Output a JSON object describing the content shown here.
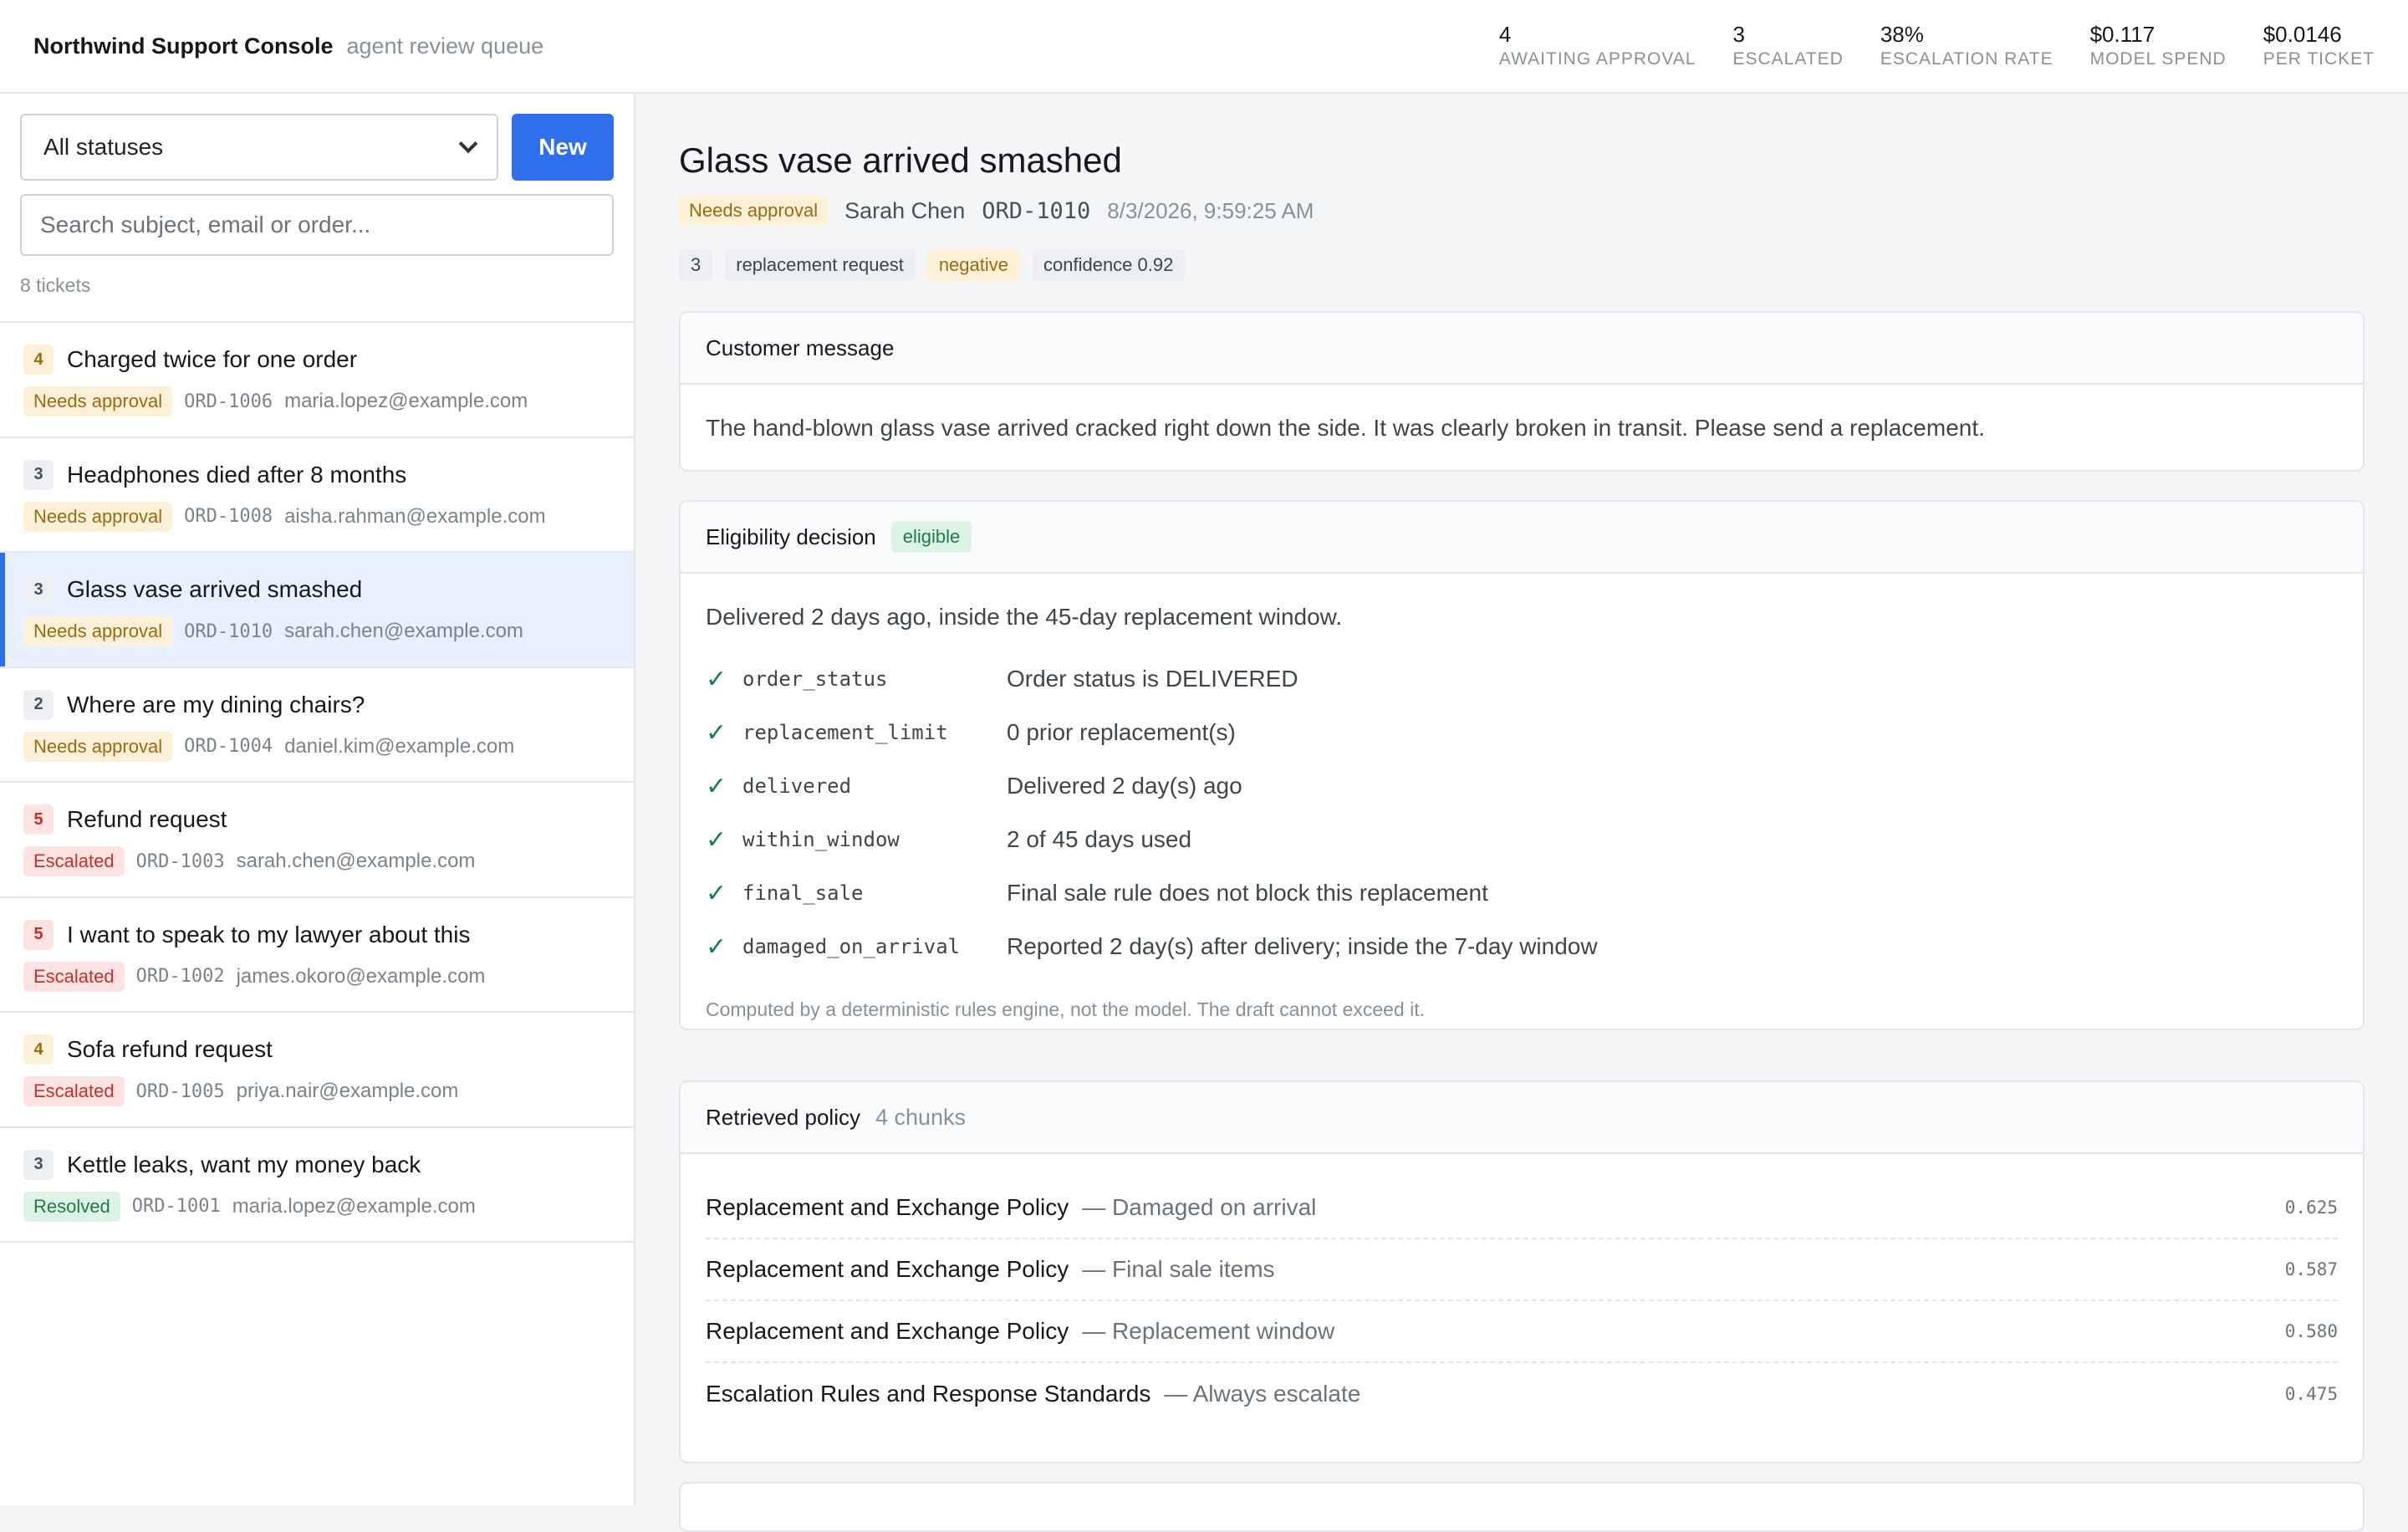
{
  "header": {
    "brand": "Northwind Support Console",
    "subtitle": "agent review queue",
    "stats": [
      {
        "value": "4",
        "label": "AWAITING APPROVAL"
      },
      {
        "value": "3",
        "label": "ESCALATED"
      },
      {
        "value": "38%",
        "label": "ESCALATION RATE"
      },
      {
        "value": "$0.117",
        "label": "MODEL SPEND"
      },
      {
        "value": "$0.0146",
        "label": "PER TICKET"
      }
    ]
  },
  "sidebar": {
    "status_filter": "All statuses",
    "new_label": "New",
    "search_placeholder": "Search subject, email or order...",
    "ticket_count": "8 tickets",
    "tickets": [
      {
        "priority": "4",
        "subject": "Charged twice for one order",
        "status": "Needs approval",
        "order": "ORD-1006",
        "email": "maria.lopez@example.com"
      },
      {
        "priority": "3",
        "subject": "Headphones died after 8 months",
        "status": "Needs approval",
        "order": "ORD-1008",
        "email": "aisha.rahman@example.com"
      },
      {
        "priority": "3",
        "subject": "Glass vase arrived smashed",
        "status": "Needs approval",
        "order": "ORD-1010",
        "email": "sarah.chen@example.com"
      },
      {
        "priority": "2",
        "subject": "Where are my dining chairs?",
        "status": "Needs approval",
        "order": "ORD-1004",
        "email": "daniel.kim@example.com"
      },
      {
        "priority": "5",
        "subject": "Refund request",
        "status": "Escalated",
        "order": "ORD-1003",
        "email": "sarah.chen@example.com"
      },
      {
        "priority": "5",
        "subject": "I want to speak to my lawyer about this",
        "status": "Escalated",
        "order": "ORD-1002",
        "email": "james.okoro@example.com"
      },
      {
        "priority": "4",
        "subject": "Sofa refund request",
        "status": "Escalated",
        "order": "ORD-1005",
        "email": "priya.nair@example.com"
      },
      {
        "priority": "3",
        "subject": "Kettle leaks, want my money back",
        "status": "Resolved",
        "order": "ORD-1001",
        "email": "maria.lopez@example.com"
      }
    ]
  },
  "detail": {
    "title": "Glass vase arrived smashed",
    "status": "Needs approval",
    "customer": "Sarah Chen",
    "order": "ORD-1010",
    "date": "8/3/2026, 9:59:25 AM",
    "chips": {
      "priority": "3",
      "intent": "replacement request",
      "sentiment": "negative",
      "confidence": "confidence 0.92"
    },
    "message_card": {
      "title": "Customer message",
      "text": "The hand-blown glass vase arrived cracked right down the side. It was clearly broken in transit. Please send a replacement."
    },
    "eligibility": {
      "title": "Eligibility decision",
      "badge": "eligible",
      "summary": "Delivered 2 days ago, inside the 45-day replacement window.",
      "checks": [
        {
          "rule": "order_status",
          "text": "Order status is DELIVERED"
        },
        {
          "rule": "replacement_limit",
          "text": "0 prior replacement(s)"
        },
        {
          "rule": "delivered",
          "text": "Delivered 2 day(s) ago"
        },
        {
          "rule": "within_window",
          "text": "2 of 45 days used"
        },
        {
          "rule": "final_sale",
          "text": "Final sale rule does not block this replacement"
        },
        {
          "rule": "damaged_on_arrival",
          "text": "Reported 2 day(s) after delivery; inside the 7-day window"
        }
      ],
      "footnote": "Computed by a deterministic rules engine, not the model. The draft cannot exceed it."
    },
    "policy": {
      "title": "Retrieved policy",
      "count": "4 chunks",
      "chunks": [
        {
          "title": "Replacement and Exchange Policy",
          "section": "— Damaged on arrival",
          "score": "0.625"
        },
        {
          "title": "Replacement and Exchange Policy",
          "section": "— Final sale items",
          "score": "0.587"
        },
        {
          "title": "Replacement and Exchange Policy",
          "section": "— Replacement window",
          "score": "0.580"
        },
        {
          "title": "Escalation Rules and Response Standards",
          "section": "— Always escalate",
          "score": "0.475"
        }
      ]
    }
  },
  "colors": {
    "accent": "#2f6fec",
    "needs_approval": "#9a6a10",
    "escalated": "#c2302b",
    "resolved": "#1f7a45"
  },
  "icons": {
    "check": "check-icon",
    "select": "chevron-down-icon"
  }
}
